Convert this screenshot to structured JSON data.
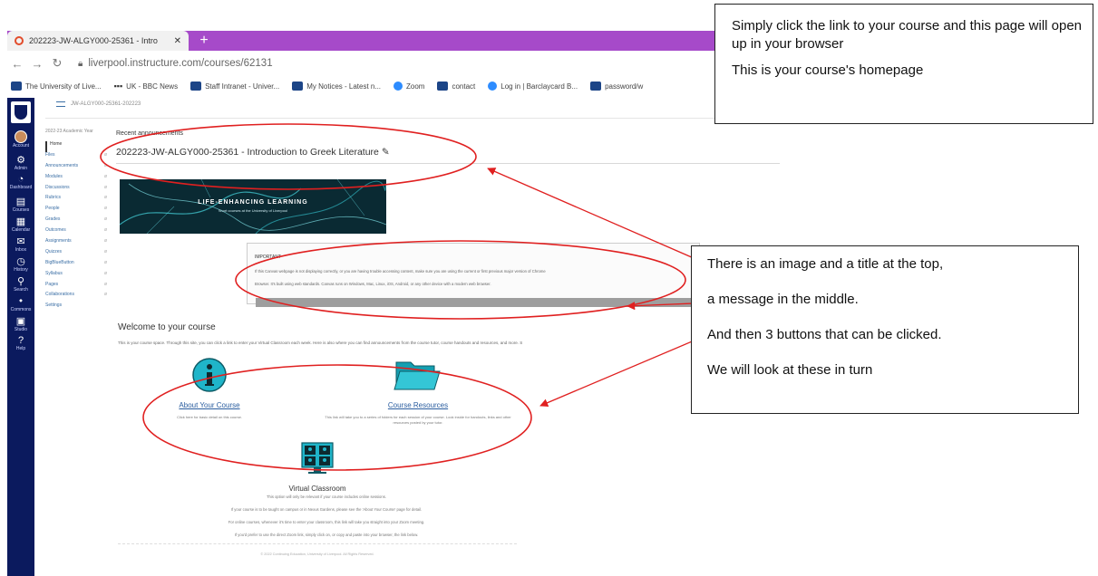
{
  "browser": {
    "tab_title": "202223-JW-ALGY000-25361 - Intro",
    "tab_close": "✕",
    "new_tab": "+",
    "url": "liverpool.instructure.com/courses/62131",
    "bookmarks": [
      {
        "label": "The University of Live...",
        "icon": "bookmark-icon"
      },
      {
        "label": "UK - BBC News",
        "icon": "bbc-icon"
      },
      {
        "label": "Staff Intranet - Univer...",
        "icon": "bookmark-icon"
      },
      {
        "label": "My Notices - Latest n...",
        "icon": "bookmark-icon"
      },
      {
        "label": "Zoom",
        "icon": "zoom-icon"
      },
      {
        "label": "contact",
        "icon": "bookmark-icon"
      },
      {
        "label": "Log in | Barclaycard B...",
        "icon": "bookmark-icon"
      },
      {
        "label": "password/w",
        "icon": "bookmark-icon"
      }
    ]
  },
  "global_nav": [
    {
      "label": "Account",
      "icon": "◉"
    },
    {
      "label": "Admin",
      "icon": "⚙"
    },
    {
      "label": "Dashboard",
      "icon": "◔"
    },
    {
      "label": "Courses",
      "icon": "▤"
    },
    {
      "label": "Calendar",
      "icon": "▦"
    },
    {
      "label": "Inbox",
      "icon": "✉"
    },
    {
      "label": "History",
      "icon": "◷"
    },
    {
      "label": "Search",
      "icon": "⚲"
    },
    {
      "label": "Commons",
      "icon": "⬩"
    },
    {
      "label": "Studio",
      "icon": "▣"
    },
    {
      "label": "Help",
      "icon": "?"
    }
  ],
  "breadcrumb": "JW-ALGY000-25361-202223",
  "course_nav": {
    "term": "2022-23 Academic Year",
    "items": [
      "Home",
      "Files",
      "Announcements",
      "Modules",
      "Discussions",
      "Rubrics",
      "People",
      "Grades",
      "Outcomes",
      "Assignments",
      "Quizzes",
      "BigBlueButton",
      "Syllabus",
      "Pages",
      "Collaborations",
      "Settings"
    ]
  },
  "main": {
    "recent_announcements": "Recent announcements",
    "course_title": "202223-JW-ALGY000-25361 - Introduction to Greek Literature",
    "banner_title": "LIFE-ENHANCING LEARNING",
    "banner_sub": "Short courses at the University of Liverpool",
    "message_heading": "IMPORTANT",
    "message_line1": "If this Canvas webpage is not displaying correctly, or you are having trouble accessing content, make sure you are using the current or first previous major version of Chrome",
    "message_line2": "Browser. It's built using web standards. Canvas runs on Windows, Mac, Linux, iOS, Android, or any other device with a modern web browser.",
    "welcome_heading": "Welcome to your course",
    "welcome_text": "This is your course space. Through this site, you can click a link to enter your Virtual Classroom each week. Here is also where you can find announcements from the course tutor, course handouts and resources, and more. S",
    "tiles": [
      {
        "label": "About Your Course",
        "desc": "Click here for basic detail on this course."
      },
      {
        "label": "Course Resources",
        "desc": "This link will take you to a series of folders for each session of your course. Look inside for handouts, links and other resources posted by your tutor."
      },
      {
        "label": "Virtual Classroom",
        "desc": "This option will only be relevant if your course includes online sessions."
      }
    ],
    "vc_lines": [
      "If your course is to be taught on campus or in Nexus Gardens, please see the 'About Your Course' page for detail.",
      "For online courses, whenever it's time to enter your classroom, this link will take you straight into your Zoom meeting.",
      "If you'd prefer to use the direct Zoom link, simply click on, or copy and paste into your browser, the link below."
    ],
    "footer": "© 2022 Continuing Education, University of Liverpool. All Rights Reserved."
  },
  "callout_top": {
    "line1": "Simply click the link to your course and this page will open up in your browser",
    "line2": "This is your course's homepage"
  },
  "callout_bottom": {
    "lines": [
      "There is an image and a title at the top,",
      "a message in the middle.",
      "And then 3 buttons that can be clicked.",
      "We will look at these in turn"
    ]
  },
  "colors": {
    "tab_strip": "#a64ac9",
    "canvas_nav": "#0b1a5e",
    "link": "#2a5d9f",
    "annotation": "#e02020",
    "tile_icon": "#1fb5c9"
  }
}
